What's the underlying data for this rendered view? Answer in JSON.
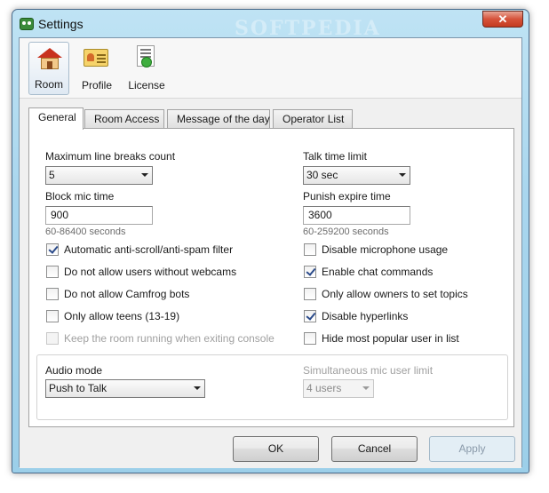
{
  "window": {
    "title": "Settings",
    "close_label": "✕",
    "watermark": "SOFTPEDIA"
  },
  "toolbar": {
    "items": [
      {
        "label": "Room",
        "icon": "room-icon",
        "active": true
      },
      {
        "label": "Profile",
        "icon": "profile-icon",
        "active": false
      },
      {
        "label": "License",
        "icon": "license-icon",
        "active": false
      }
    ]
  },
  "tabs": [
    {
      "label": "General",
      "active": true
    },
    {
      "label": "Room Access",
      "active": false
    },
    {
      "label": "Message of the day",
      "active": false
    },
    {
      "label": "Operator List",
      "active": false
    }
  ],
  "general": {
    "max_line_breaks": {
      "label": "Maximum line breaks count",
      "value": "5"
    },
    "talk_time": {
      "label": "Talk time limit",
      "value": "30 sec"
    },
    "block_mic": {
      "label": "Block mic time",
      "value": "900",
      "hint": "60-86400 seconds"
    },
    "punish_expire": {
      "label": "Punish expire time",
      "value": "3600",
      "hint": "60-259200 seconds"
    },
    "left_checks": [
      {
        "label": "Automatic anti-scroll/anti-spam filter",
        "checked": true,
        "enabled": true
      },
      {
        "label": "Do not allow users without webcams",
        "checked": false,
        "enabled": true
      },
      {
        "label": "Do not allow Camfrog bots",
        "checked": false,
        "enabled": true
      },
      {
        "label": "Only allow teens (13-19)",
        "checked": false,
        "enabled": true
      },
      {
        "label": "Keep the room running when exiting console",
        "checked": false,
        "enabled": false
      }
    ],
    "right_checks": [
      {
        "label": "Disable microphone usage",
        "checked": false,
        "enabled": true
      },
      {
        "label": "Enable chat commands",
        "checked": true,
        "enabled": true
      },
      {
        "label": "Only allow owners to set topics",
        "checked": false,
        "enabled": true
      },
      {
        "label": "Disable hyperlinks",
        "checked": true,
        "enabled": true
      },
      {
        "label": "Hide most popular user in list",
        "checked": false,
        "enabled": true
      }
    ],
    "audio_mode": {
      "label": "Audio mode",
      "value": "Push to Talk"
    },
    "sim_mic": {
      "label": "Simultaneous mic user limit",
      "value": "4 users"
    }
  },
  "buttons": {
    "ok": "OK",
    "cancel": "Cancel",
    "apply": "Apply"
  }
}
